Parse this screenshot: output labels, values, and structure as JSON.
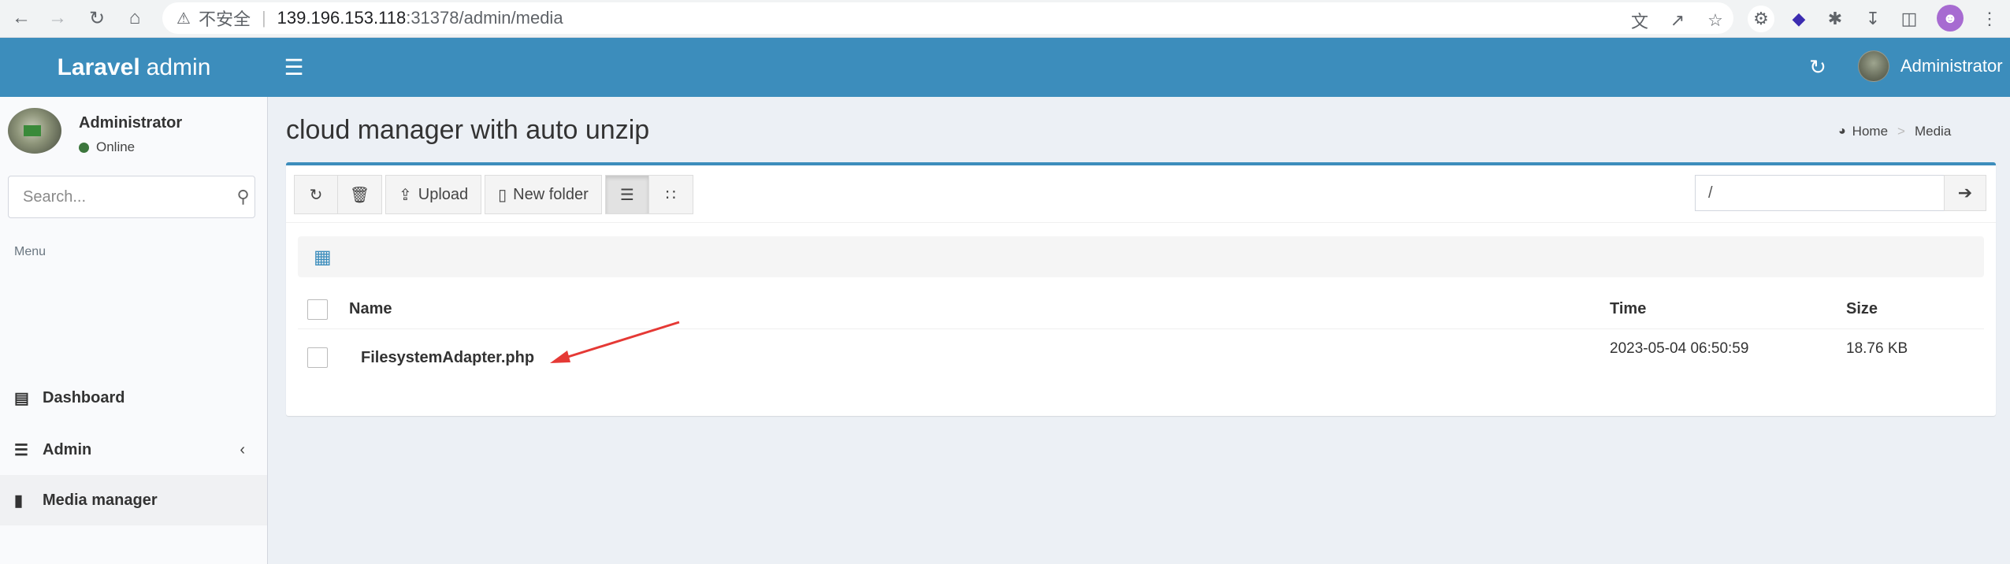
{
  "browser": {
    "insecure_label": "不安全",
    "url_host": "139.196.153.118",
    "url_rest": ":31378/admin/media"
  },
  "header": {
    "logo_bold": "Laravel",
    "logo_rest": "admin",
    "user_name": "Administrator",
    "theme_color": "#3c8dbc"
  },
  "sidebar": {
    "user": {
      "name": "Administrator",
      "status": "Online"
    },
    "search_placeholder": "Search...",
    "menu_header": "Menu",
    "items": [
      {
        "label": "Dashboard",
        "icon": "bar-chart-icon"
      },
      {
        "label": "Admin",
        "icon": "tasks-icon"
      },
      {
        "label": "Media manager",
        "icon": "file-icon"
      }
    ]
  },
  "content": {
    "title": "cloud manager with auto unzip",
    "breadcrumb": {
      "home": "Home",
      "current": "Media"
    },
    "toolbar": {
      "upload": "Upload",
      "new_folder": "New folder"
    },
    "path_value": "/",
    "table": {
      "headers": {
        "name": "Name",
        "time": "Time",
        "size": "Size"
      },
      "rows": [
        {
          "name": "FilesystemAdapter.php",
          "time": "2023-05-04 06:50:59",
          "size": "18.76 KB"
        }
      ]
    }
  }
}
